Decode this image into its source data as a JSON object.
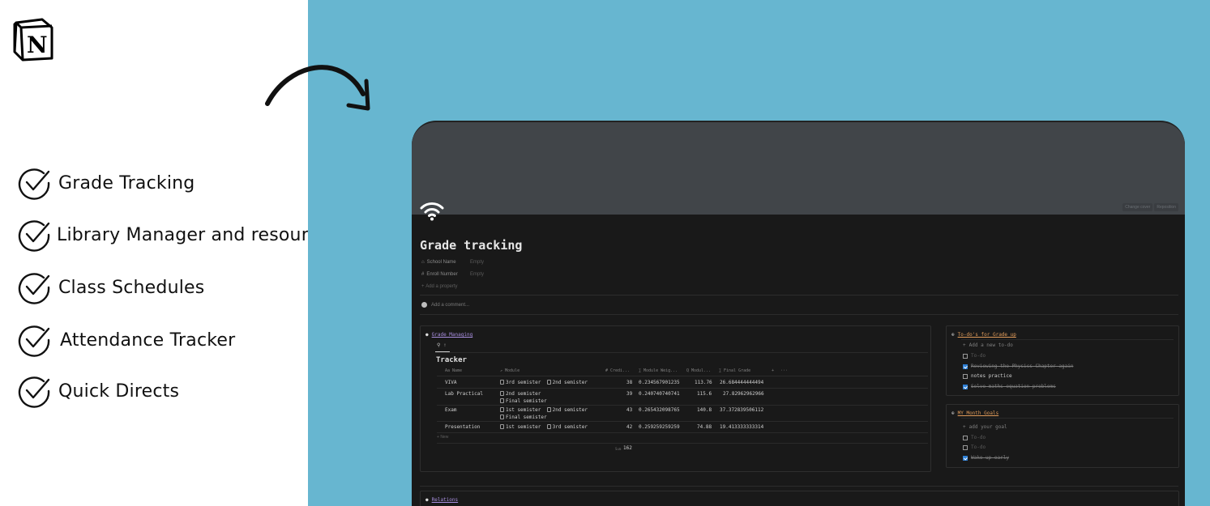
{
  "features": [
    {
      "label": "Grade Tracking"
    },
    {
      "label": "Library Manager and resources"
    },
    {
      "label": "Class Schedules"
    },
    {
      "label": "Attendance Tracker"
    },
    {
      "label": "Quick Directs"
    }
  ],
  "colors": {
    "panel_bg": "#67b6d0",
    "window_bg": "#191919",
    "cover": "#414549",
    "accent_purple": "#a98fe0",
    "accent_orange": "#e09b5a",
    "checkbox": "#2f80d6"
  },
  "notion": {
    "cover_buttons": [
      "Change cover",
      "Reposition"
    ],
    "page_title": "Grade tracking",
    "properties": [
      {
        "name": "School Name",
        "value": "Empty"
      },
      {
        "name": "Enroll Number",
        "value": "Empty"
      }
    ],
    "add_property": "Add a property",
    "add_comment": "Add a comment...",
    "grade_box": {
      "title": "Grade Managing",
      "view_tab": "↑",
      "db_title": "Tracker",
      "columns": [
        "Aa Name",
        "↗ Module",
        "# Credi...",
        "∑ Module Weig...",
        "Q Modul...",
        "∑ Final Grade",
        "+",
        "···"
      ],
      "rows": [
        {
          "name": "VIVA",
          "modules": [
            "3rd semister",
            "2nd semister"
          ],
          "credits": "38",
          "weight": "0.234567901235",
          "modul": "113.76",
          "final": "26.684444444494"
        },
        {
          "name": "Lab Practical",
          "modules": [
            "2nd semister",
            "Final semister"
          ],
          "credits": "39",
          "weight": "0.240740740741",
          "modul": "115.6",
          "final": "27.82962962966"
        },
        {
          "name": "Exam",
          "modules": [
            "1st semister",
            "2nd semister",
            "Final semister"
          ],
          "credits": "43",
          "weight": "0.265432098765",
          "modul": "140.8",
          "final": "37.372839506112"
        },
        {
          "name": "Presentation",
          "modules": [
            "1st semister",
            "3rd semister"
          ],
          "credits": "42",
          "weight": "0.259259259259",
          "modul": "74.88",
          "final": "19.413333333314"
        }
      ],
      "new_label": "New",
      "sum_label": "Sum",
      "sum_value": "162"
    },
    "todo_box": {
      "title": "To-do's for Grade up",
      "add_label": "Add a new to-do",
      "items": [
        {
          "text": "To-do",
          "checked": false,
          "placeholder": true
        },
        {
          "text": "Reviewing the Physics Chapter again",
          "checked": true,
          "placeholder": false
        },
        {
          "text": "notes practice",
          "checked": false,
          "placeholder": false
        },
        {
          "text": "Solve maths equation problems",
          "checked": true,
          "placeholder": false
        }
      ]
    },
    "goals_box": {
      "title": "MY Month Goals",
      "add_label": "add your goal",
      "items": [
        {
          "text": "To-do",
          "checked": false,
          "placeholder": true
        },
        {
          "text": "To-do",
          "checked": false,
          "placeholder": true
        },
        {
          "text": "Wake up early",
          "checked": true,
          "placeholder": false
        }
      ]
    },
    "relations_box": {
      "title": "Relations"
    }
  }
}
